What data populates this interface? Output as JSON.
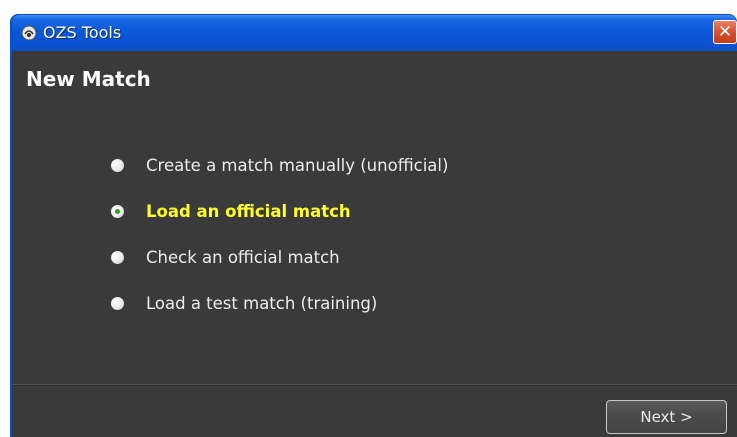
{
  "window": {
    "title": "OZS Tools",
    "close_glyph": "✕",
    "icon": "app-logo-icon"
  },
  "page": {
    "title": "New Match"
  },
  "options": [
    {
      "label": "Create a match manually (unofficial)",
      "selected": false
    },
    {
      "label": "Load an official match",
      "selected": true
    },
    {
      "label": "Check an official match",
      "selected": false
    },
    {
      "label": "Load a test match (training)",
      "selected": false
    }
  ],
  "footer": {
    "next_label": "Next >"
  },
  "colors": {
    "titlebar": "#0a57d8",
    "panel_bg": "#3a3a3a",
    "selected_text": "#ffff2a",
    "normal_text": "#ececec"
  }
}
